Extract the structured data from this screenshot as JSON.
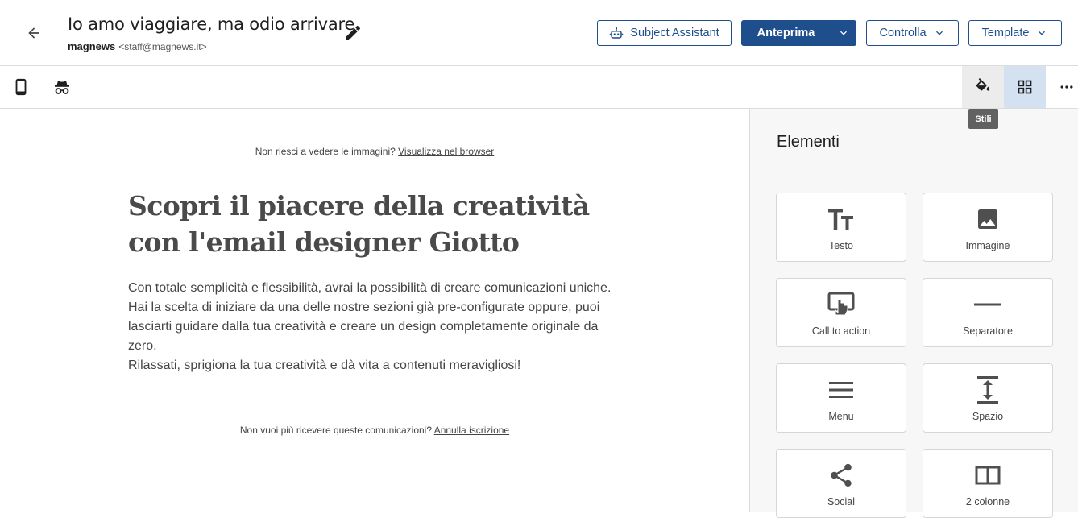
{
  "header": {
    "subject": "Io amo viaggiare, ma odio arrivare.",
    "sender_name": "magnews",
    "sender_email": "<staff@magnews.it>",
    "buttons": {
      "subject_assistant": "Subject Assistant",
      "preview": "Anteprima",
      "check": "Controlla",
      "template": "Template"
    }
  },
  "toolbar": {
    "tooltip": "Stili"
  },
  "email": {
    "preheader_text": "Non riesci a vedere le immagini?",
    "preheader_link": "Visualizza nel browser",
    "headline_line1": "Scopri il piacere della creatività",
    "headline_line2": "con l'email designer Giotto",
    "paragraphs": [
      "Con totale semplicità e flessibilità, avrai la possibilità di creare comunicazioni uniche.",
      "Hai la scelta di iniziare da una delle nostre sezioni già pre-configurate oppure, puoi lasciarti guidare dalla tua creatività e creare un design completamente originale da zero.",
      "Rilassati, sprigiona la tua creatività e dà vita a contenuti meravigliosi!"
    ],
    "footer_text": "Non vuoi più ricevere queste comunicazioni?",
    "footer_link": "Annulla iscrizione"
  },
  "sidebar": {
    "title": "Elementi",
    "items": [
      {
        "label": "Testo",
        "icon": "text-icon"
      },
      {
        "label": "Immagine",
        "icon": "image-icon"
      },
      {
        "label": "Call to action",
        "icon": "call-to-action-icon"
      },
      {
        "label": "Separatore",
        "icon": "separator-icon"
      },
      {
        "label": "Menu",
        "icon": "menu-icon"
      },
      {
        "label": "Spazio",
        "icon": "spacer-icon"
      },
      {
        "label": "Social",
        "icon": "share-icon"
      },
      {
        "label": "2 colonne",
        "icon": "two-columns-icon"
      }
    ]
  },
  "colors": {
    "primary": "#1f4e8c",
    "icon_gray": "#4f4f4f",
    "selected_tab": "#d3e1f0",
    "tooltip_bg": "#616161"
  }
}
